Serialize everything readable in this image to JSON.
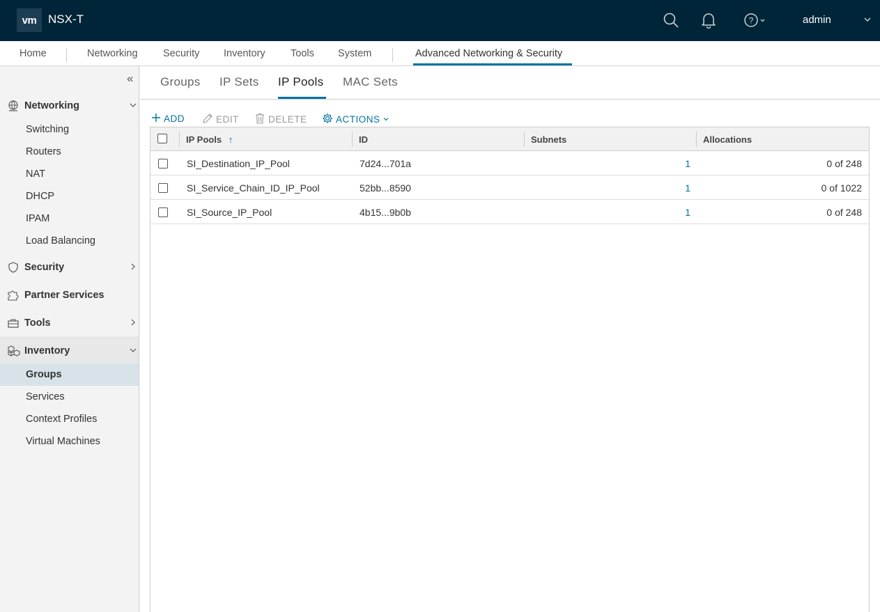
{
  "header": {
    "logo": "vm",
    "app_title": "NSX-T",
    "user": "admin"
  },
  "main_nav": {
    "items": [
      {
        "label": "Home"
      },
      {
        "label": "Networking"
      },
      {
        "label": "Security"
      },
      {
        "label": "Inventory"
      },
      {
        "label": "Tools"
      },
      {
        "label": "System"
      },
      {
        "label": "Advanced Networking & Security",
        "active": true
      }
    ]
  },
  "sidebar": {
    "collapse_glyph": "«",
    "sections": [
      {
        "label": "Networking",
        "icon": "networking-icon",
        "expanded": true,
        "items": [
          "Switching",
          "Routers",
          "NAT",
          "DHCP",
          "IPAM",
          "Load Balancing"
        ]
      },
      {
        "label": "Security",
        "icon": "shield-icon",
        "expanded": false
      },
      {
        "label": "Partner Services",
        "icon": "puzzle-icon"
      },
      {
        "label": "Tools",
        "icon": "toolbox-icon",
        "expanded": false
      },
      {
        "label": "Inventory",
        "icon": "blocks-icon",
        "expanded": true,
        "items": [
          "Groups",
          "Services",
          "Context Profiles",
          "Virtual Machines"
        ],
        "selected": "Groups"
      }
    ]
  },
  "tabs": [
    {
      "label": "Groups"
    },
    {
      "label": "IP Sets"
    },
    {
      "label": "IP Pools",
      "active": true
    },
    {
      "label": "MAC Sets"
    }
  ],
  "toolbar": {
    "add": "ADD",
    "edit": "EDIT",
    "delete": "DELETE",
    "actions": "ACTIONS"
  },
  "table": {
    "columns": [
      "IP Pools",
      "ID",
      "Subnets",
      "Allocations"
    ],
    "sort_glyph": "↑",
    "rows": [
      {
        "name": "SI_Destination_IP_Pool",
        "id": "7d24...701a",
        "subnets": "1",
        "allocations": "0 of 248"
      },
      {
        "name": "SI_Service_Chain_ID_IP_Pool",
        "id": "52bb...8590",
        "subnets": "1",
        "allocations": "0 of 1022"
      },
      {
        "name": "SI_Source_IP_Pool",
        "id": "4b15...9b0b",
        "subnets": "1",
        "allocations": "0 of 248"
      }
    ]
  },
  "colors": {
    "header_bg": "#002538",
    "accent": "#0072a3",
    "sidebar_bg": "#f3f3f3",
    "selected_bg": "#d8e3e9"
  }
}
